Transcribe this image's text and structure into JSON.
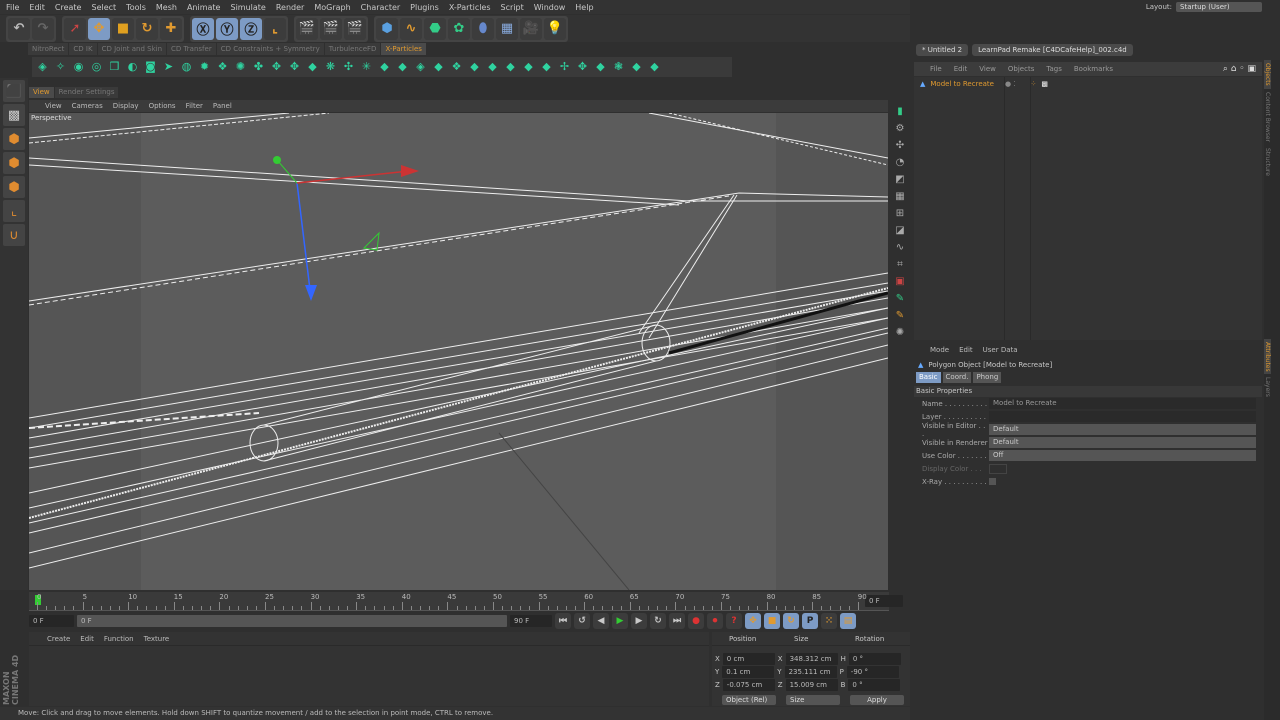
{
  "menu": [
    "File",
    "Edit",
    "Create",
    "Select",
    "Tools",
    "Mesh",
    "Animate",
    "Simulate",
    "Render",
    "MoGraph",
    "Character",
    "Plugins",
    "X-Particles",
    "Script",
    "Window",
    "Help"
  ],
  "plugin_tabs": [
    "NitroRect",
    "CD IK",
    "CD Joint and Skin",
    "CD Transfer",
    "CD Constraints + Symmetry",
    "TurbulenceFD",
    "X-Particles"
  ],
  "view_tabs": [
    "View",
    "Render Settings"
  ],
  "view_menu": [
    "View",
    "Cameras",
    "Display",
    "Options",
    "Filter",
    "Panel"
  ],
  "viewport_label": "Perspective",
  "timeline": {
    "ticks": [
      "0",
      "5",
      "10",
      "15",
      "20",
      "25",
      "30",
      "35",
      "40",
      "45",
      "50",
      "55",
      "60",
      "65",
      "70",
      "75",
      "80",
      "85",
      "90"
    ],
    "current": "0 F",
    "start": "0 F",
    "range_start": "0 F",
    "range_end": "90 F",
    "end": "90 F"
  },
  "material_menu": [
    "Create",
    "Edit",
    "Function",
    "Texture"
  ],
  "brand": "MAXON CINEMA 4D",
  "coords": {
    "headers": [
      "Position",
      "Size",
      "Rotation"
    ],
    "rows": [
      {
        "axis": "X",
        "pos": "0 cm",
        "size_axis": "X",
        "size": "348.312 cm",
        "rot_axis": "H",
        "rot": "0 °"
      },
      {
        "axis": "Y",
        "pos": "0.1 cm",
        "size_axis": "Y",
        "size": "235.111 cm",
        "rot_axis": "P",
        "rot": "-90 °"
      },
      {
        "axis": "Z",
        "pos": "-0.075 cm",
        "size_axis": "Z",
        "size": "15.009 cm",
        "rot_axis": "B",
        "rot": "0 °"
      }
    ],
    "mode": "Object (Rel)",
    "size_mode": "Size",
    "apply": "Apply"
  },
  "status": "Move: Click and drag to move elements. Hold down SHIFT to quantize movement / add to the selection in point mode, CTRL to remove.",
  "layout": {
    "label": "Layout:",
    "value": "Startup (User)"
  },
  "doc_tabs": [
    "* Untitled 2",
    "LearnPad Remake [C4DCafeHelp]_002.c4d"
  ],
  "object_menu": [
    "File",
    "Edit",
    "View",
    "Objects",
    "Tags",
    "Bookmarks"
  ],
  "object": "Model to Recreate",
  "attr_menu": [
    "Mode",
    "Edit",
    "User Data"
  ],
  "attr_title": "Polygon Object [Model to Recreate]",
  "attr_tabs": [
    "Basic",
    "Coord.",
    "Phong"
  ],
  "section": "Basic Properties",
  "props": [
    {
      "label": "Name . . . . . . . . . .",
      "value": "Model to Recreate"
    },
    {
      "label": "Layer . . . . . . . . . .",
      "value": ""
    },
    {
      "label": "Visible in Editor . . .",
      "value": "Default"
    },
    {
      "label": "Visible in Renderer",
      "value": "Default"
    },
    {
      "label": "Use Color . . . . . . .",
      "value": "Off"
    },
    {
      "label": "Display Color . . .",
      "value": ""
    },
    {
      "label": "X-Ray . . . . . . . . . .",
      "value": ""
    }
  ],
  "side_tabs": [
    "Objects",
    "Content Browser",
    "Structure",
    "Attributes",
    "Layers"
  ],
  "accent": "#e09a30"
}
